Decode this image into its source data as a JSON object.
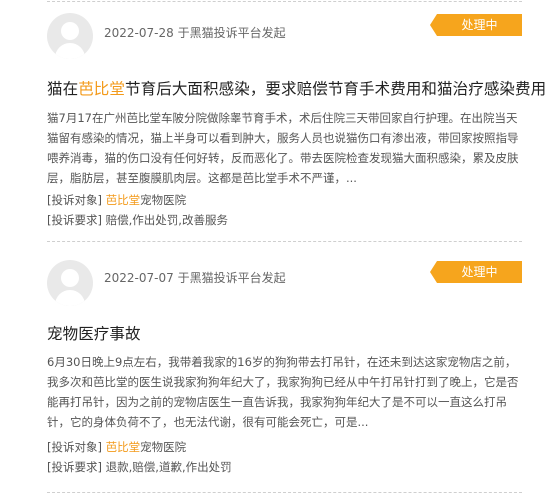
{
  "complaints": [
    {
      "date": "2022-07-28",
      "source": "于黑猫投诉平台发起",
      "status": "处理中",
      "title_prefix": "猫在",
      "title_highlight": "芭比堂",
      "title_suffix": "节育后大面积感染，要求赔偿节育手术费用和猫治疗感染费用",
      "description": "猫7月17在广州芭比堂车陂分院做除睾节育手术，术后住院三天带回家自行护理。在出院当天猫留有感染的情况，猫上半身可以看到肿大，服务人员也说猫伤口有渗出液，带回家按照指导喂养消毒，猫的伤口没有任何好转，反而恶化了。带去医院检查发现猫大面积感染，累及皮肤层，脂肪层，甚至腹膜肌肉层。这都是芭比堂手术不严谨，...",
      "target_label": "[投诉对象]",
      "target_highlight": "芭比堂",
      "target_suffix": "宠物医院",
      "demand_label": "[投诉要求]",
      "demand_value": "赔偿,作出处罚,改善服务"
    },
    {
      "date": "2022-07-07",
      "source": "于黑猫投诉平台发起",
      "status": "处理中",
      "title_prefix": "宠物医疗事故",
      "title_highlight": "",
      "title_suffix": "",
      "description": "6月30日晚上9点左右，我带着我家的16岁的狗狗带去打吊针，在还未到达这家宠物店之前，我多次和芭比堂的医生说我家狗狗年纪大了，我家狗狗已经从中午打吊针打到了晚上，它是否能再打吊针，因为之前的宠物店医生一直告诉我，我家狗狗年纪大了是不可以一直这么打吊针，它的身体负荷不了，也无法代谢，很有可能会死亡，可是...",
      "target_label": "[投诉对象]",
      "target_highlight": "芭比堂",
      "target_suffix": "宠物医院",
      "demand_label": "[投诉要求]",
      "demand_value": "退款,赔偿,道歉,作出处罚"
    }
  ]
}
